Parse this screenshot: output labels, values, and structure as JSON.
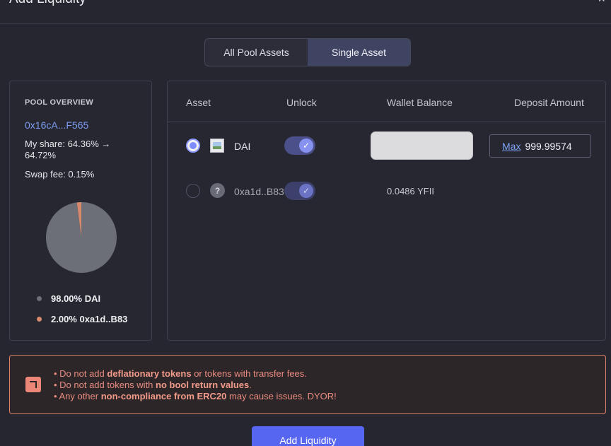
{
  "modal": {
    "title": "Add Liquidity",
    "close_glyph": "×"
  },
  "mode_toggle": {
    "options": [
      "All Pool Assets",
      "Single Asset"
    ],
    "selected": "Single Asset"
  },
  "pool_overview": {
    "label": "POOL OVERVIEW",
    "address": "0x16cA...F565",
    "share_text": "My share: 64.36% → 64.72%",
    "fee_text": "Swap fee: 0.15%",
    "composition": [
      {
        "percent": 98,
        "label": "98.00% DAI",
        "color": "#6c6e78"
      },
      {
        "percent": 2,
        "label": "2.00% 0xa1d..B83",
        "color": "#d8896b"
      }
    ]
  },
  "assets_table": {
    "headers": [
      "Asset",
      "Unlock",
      "Wallet Balance",
      "Deposit Amount"
    ],
    "rows": [
      {
        "selected": true,
        "icon": "image-icon",
        "name": "DAI",
        "unlocked": true,
        "balance": "",
        "max_label": "Max",
        "deposit": "999.99574"
      },
      {
        "selected": false,
        "icon": "question-icon",
        "icon_glyph": "?",
        "name": "0xa1d..B83",
        "unlocked": true,
        "balance": "0.0486 YFII"
      }
    ]
  },
  "warning": {
    "icon": "alert-icon",
    "lines": [
      {
        "pre": "• Do not add ",
        "bold": "deflationary tokens",
        "post": " or tokens with transfer fees."
      },
      {
        "pre": "• Do not add tokens with ",
        "bold": "no bool return values",
        "post": "."
      },
      {
        "pre": "• Any other ",
        "bold": "non-compliance from ERC20",
        "post": " may cause issues. DYOR!"
      }
    ]
  },
  "footer": {
    "submit_label": "Add Liquidity"
  },
  "colors": {
    "accent": "#5766f0",
    "link": "#7d9df0",
    "warning": "#e0826e"
  }
}
